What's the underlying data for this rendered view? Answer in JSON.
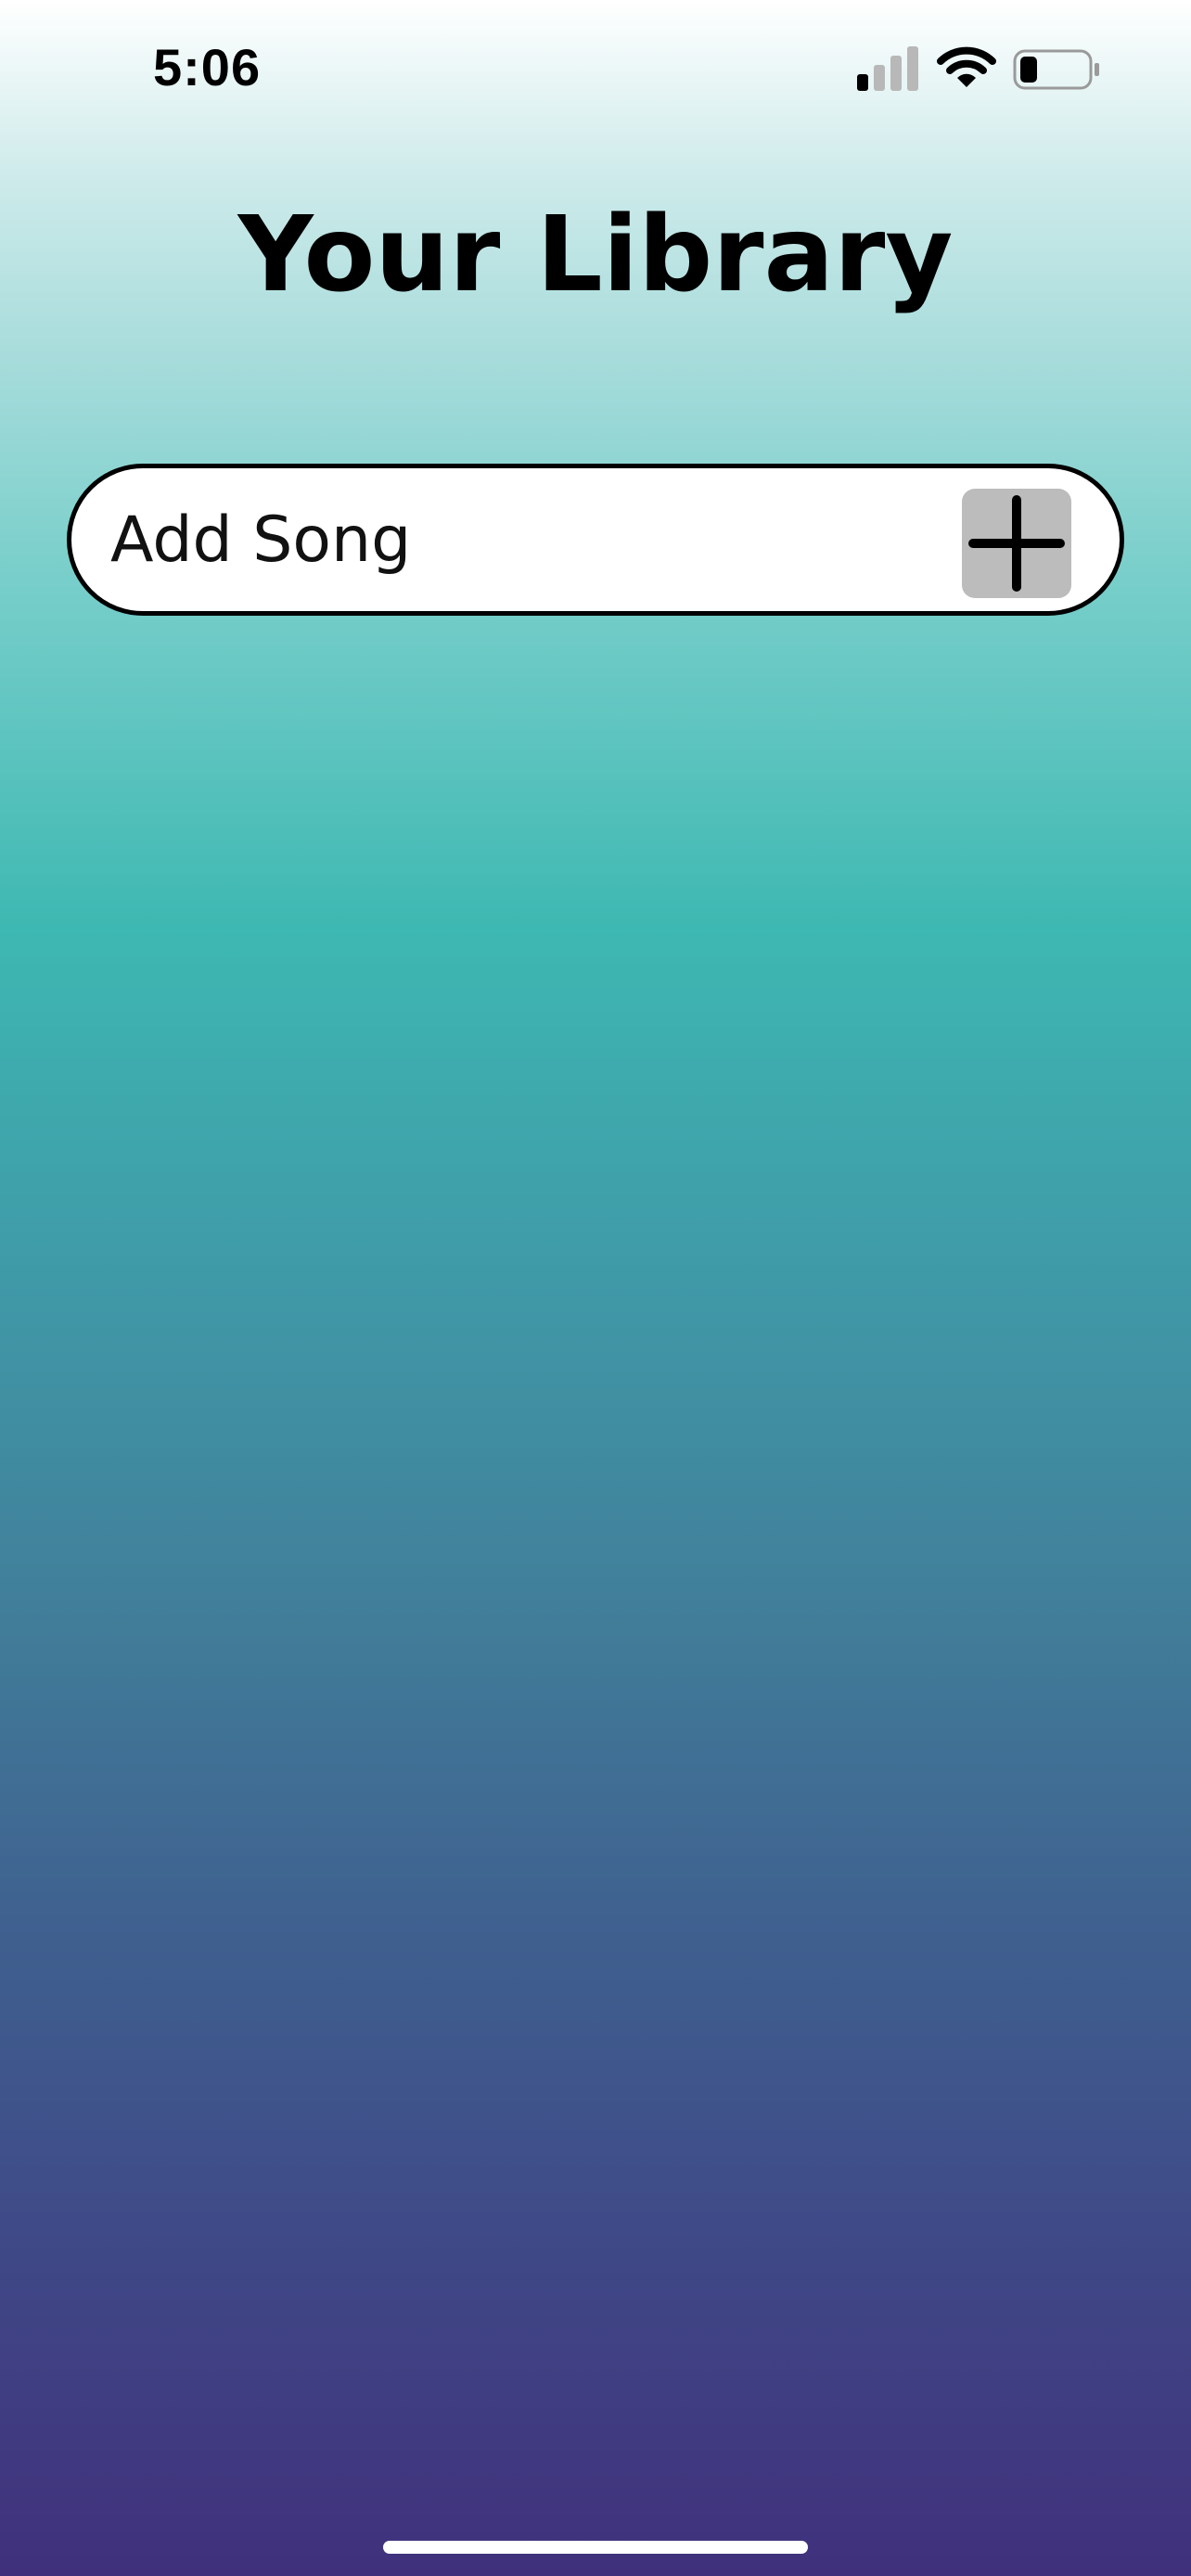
{
  "status_bar": {
    "time": "5:06",
    "signal_icon": "cellular-signal-icon",
    "wifi_icon": "wifi-icon",
    "battery_icon": "battery-icon",
    "battery_level": 0.25
  },
  "header": {
    "title": "Your Library"
  },
  "add_song": {
    "placeholder": "Add Song",
    "value": "",
    "button_icon": "plus-icon",
    "button_color": "#bcbcbc"
  },
  "colors": {
    "gradient_top": "#ffffff",
    "gradient_mid": "#3eb8b2",
    "gradient_bottom": "#40307c"
  }
}
